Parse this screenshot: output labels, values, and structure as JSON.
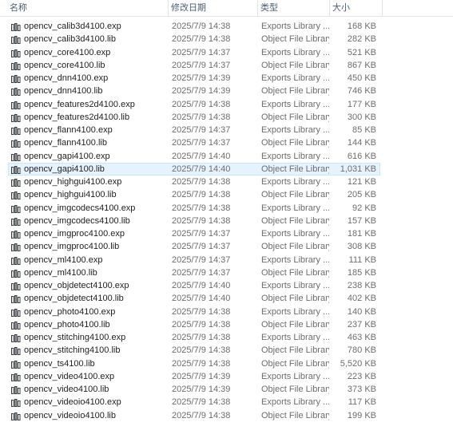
{
  "header": {
    "name": "名称",
    "date": "修改日期",
    "type": "类型",
    "size": "大小"
  },
  "files": [
    {
      "name": "opencv_calib3d4100.exp",
      "date": "2025/7/9 14:38",
      "type": "Exports Library ...",
      "size": "168 KB",
      "icon": "library-file-icon"
    },
    {
      "name": "opencv_calib3d4100.lib",
      "date": "2025/7/9 14:38",
      "type": "Object File Library",
      "size": "282 KB",
      "icon": "library-file-icon"
    },
    {
      "name": "opencv_core4100.exp",
      "date": "2025/7/9 14:37",
      "type": "Exports Library ...",
      "size": "521 KB",
      "icon": "library-file-icon"
    },
    {
      "name": "opencv_core4100.lib",
      "date": "2025/7/9 14:37",
      "type": "Object File Library",
      "size": "867 KB",
      "icon": "library-file-icon"
    },
    {
      "name": "opencv_dnn4100.exp",
      "date": "2025/7/9 14:39",
      "type": "Exports Library ...",
      "size": "450 KB",
      "icon": "library-file-icon"
    },
    {
      "name": "opencv_dnn4100.lib",
      "date": "2025/7/9 14:39",
      "type": "Object File Library",
      "size": "746 KB",
      "icon": "library-file-icon"
    },
    {
      "name": "opencv_features2d4100.exp",
      "date": "2025/7/9 14:38",
      "type": "Exports Library ...",
      "size": "177 KB",
      "icon": "library-file-icon"
    },
    {
      "name": "opencv_features2d4100.lib",
      "date": "2025/7/9 14:38",
      "type": "Object File Library",
      "size": "300 KB",
      "icon": "library-file-icon"
    },
    {
      "name": "opencv_flann4100.exp",
      "date": "2025/7/9 14:37",
      "type": "Exports Library ...",
      "size": "85 KB",
      "icon": "library-file-icon"
    },
    {
      "name": "opencv_flann4100.lib",
      "date": "2025/7/9 14:37",
      "type": "Object File Library",
      "size": "144 KB",
      "icon": "library-file-icon"
    },
    {
      "name": "opencv_gapi4100.exp",
      "date": "2025/7/9 14:40",
      "type": "Exports Library ...",
      "size": "616 KB",
      "icon": "library-file-icon"
    },
    {
      "name": "opencv_gapi4100.lib",
      "date": "2025/7/9 14:40",
      "type": "Object File Library",
      "size": "1,031 KB",
      "icon": "library-file-icon",
      "selected": true
    },
    {
      "name": "opencv_highgui4100.exp",
      "date": "2025/7/9 14:38",
      "type": "Exports Library ...",
      "size": "121 KB",
      "icon": "library-file-icon"
    },
    {
      "name": "opencv_highgui4100.lib",
      "date": "2025/7/9 14:38",
      "type": "Object File Library",
      "size": "205 KB",
      "icon": "library-file-icon"
    },
    {
      "name": "opencv_imgcodecs4100.exp",
      "date": "2025/7/9 14:38",
      "type": "Exports Library ...",
      "size": "92 KB",
      "icon": "library-file-icon"
    },
    {
      "name": "opencv_imgcodecs4100.lib",
      "date": "2025/7/9 14:38",
      "type": "Object File Library",
      "size": "157 KB",
      "icon": "library-file-icon"
    },
    {
      "name": "opencv_imgproc4100.exp",
      "date": "2025/7/9 14:37",
      "type": "Exports Library ...",
      "size": "181 KB",
      "icon": "library-file-icon"
    },
    {
      "name": "opencv_imgproc4100.lib",
      "date": "2025/7/9 14:37",
      "type": "Object File Library",
      "size": "308 KB",
      "icon": "library-file-icon"
    },
    {
      "name": "opencv_ml4100.exp",
      "date": "2025/7/9 14:37",
      "type": "Exports Library ...",
      "size": "111 KB",
      "icon": "library-file-icon"
    },
    {
      "name": "opencv_ml4100.lib",
      "date": "2025/7/9 14:37",
      "type": "Object File Library",
      "size": "185 KB",
      "icon": "library-file-icon"
    },
    {
      "name": "opencv_objdetect4100.exp",
      "date": "2025/7/9 14:40",
      "type": "Exports Library ...",
      "size": "238 KB",
      "icon": "library-file-icon"
    },
    {
      "name": "opencv_objdetect4100.lib",
      "date": "2025/7/9 14:40",
      "type": "Object File Library",
      "size": "402 KB",
      "icon": "library-file-icon"
    },
    {
      "name": "opencv_photo4100.exp",
      "date": "2025/7/9 14:38",
      "type": "Exports Library ...",
      "size": "140 KB",
      "icon": "library-file-icon"
    },
    {
      "name": "opencv_photo4100.lib",
      "date": "2025/7/9 14:38",
      "type": "Object File Library",
      "size": "237 KB",
      "icon": "library-file-icon"
    },
    {
      "name": "opencv_stitching4100.exp",
      "date": "2025/7/9 14:38",
      "type": "Exports Library ...",
      "size": "463 KB",
      "icon": "library-file-icon"
    },
    {
      "name": "opencv_stitching4100.lib",
      "date": "2025/7/9 14:38",
      "type": "Object File Library",
      "size": "780 KB",
      "icon": "library-file-icon"
    },
    {
      "name": "opencv_ts4100.lib",
      "date": "2025/7/9 14:38",
      "type": "Object File Library",
      "size": "5,520 KB",
      "icon": "library-file-icon"
    },
    {
      "name": "opencv_video4100.exp",
      "date": "2025/7/9 14:39",
      "type": "Exports Library ...",
      "size": "223 KB",
      "icon": "library-file-icon"
    },
    {
      "name": "opencv_video4100.lib",
      "date": "2025/7/9 14:39",
      "type": "Object File Library",
      "size": "373 KB",
      "icon": "library-file-icon"
    },
    {
      "name": "opencv_videoio4100.exp",
      "date": "2025/7/9 14:38",
      "type": "Exports Library ...",
      "size": "117 KB",
      "icon": "library-file-icon"
    },
    {
      "name": "opencv_videoio4100.lib",
      "date": "2025/7/9 14:38",
      "type": "Object File Library",
      "size": "199 KB",
      "icon": "library-file-icon"
    }
  ],
  "colors": {
    "header_text": "#4c607a",
    "selection_bg": "#e5f3ff",
    "selection_border": "#cce8ff",
    "secondary_text": "#6d6d6d"
  }
}
